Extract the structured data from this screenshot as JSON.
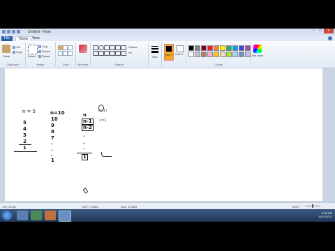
{
  "window": {
    "title": "Untitled - Paint",
    "controls": [
      "–",
      "□",
      "✕"
    ]
  },
  "tabs": [
    {
      "label": "File"
    },
    {
      "label": "Home"
    },
    {
      "label": "View"
    }
  ],
  "ribbon": {
    "clipboard": {
      "paste": "Paste",
      "cut": "Cut",
      "copy": "Copy",
      "label": "Clipboard"
    },
    "image": {
      "select": "Select",
      "crop": "Crop",
      "resize": "Resize",
      "rotate": "Rotate",
      "label": "Image"
    },
    "tools": {
      "label": "Tools"
    },
    "brushes": {
      "label": "Brushes"
    },
    "shapes": {
      "outline": "Outline",
      "fill": "Fill",
      "label": "Shapes"
    },
    "size": {
      "label": "Size"
    },
    "color1": {
      "label": "Color 1"
    },
    "color2": {
      "label": "Color 2"
    },
    "colors": {
      "label": "Colors",
      "edit": "Edit colors"
    },
    "palette_top": [
      "#000000",
      "#7f7f7f",
      "#880015",
      "#ed1c24",
      "#ff7f27",
      "#fff200",
      "#22b14c",
      "#00a2e8",
      "#3f48cc",
      "#a349a4"
    ],
    "palette_bottom": [
      "#ffffff",
      "#c3c3c3",
      "#b97a57",
      "#ffaec9",
      "#ffc90e",
      "#efe4b0",
      "#b5e61d",
      "#99d9ea",
      "#7092be",
      "#c8bfe7"
    ],
    "accent_color1": "#000000",
    "accent_color2": "#ffffff",
    "selected_tool_color": "#f5a623"
  },
  "canvas": {
    "col1": {
      "header": "n = 5",
      "values": [
        "5",
        "4",
        "3",
        "2",
        "1"
      ]
    },
    "col2": {
      "header": "n=10",
      "values": [
        "10",
        "9",
        "8",
        "7",
        ".",
        ".",
        ".",
        "1"
      ]
    },
    "col3": {
      "items": [
        "n",
        "n-1",
        "n-2",
        ".",
        ".",
        ".",
        "1"
      ]
    },
    "annotations": [
      "(n-1)",
      "1=1"
    ]
  },
  "status": {
    "cursor": "170, 191px",
    "selection": "",
    "dimensions": "1307 × 554px",
    "size": "Size: 12.8KB",
    "zoom": "100%"
  },
  "taskbar": {
    "time": "8:35 PM",
    "date": "11/10/2013"
  }
}
